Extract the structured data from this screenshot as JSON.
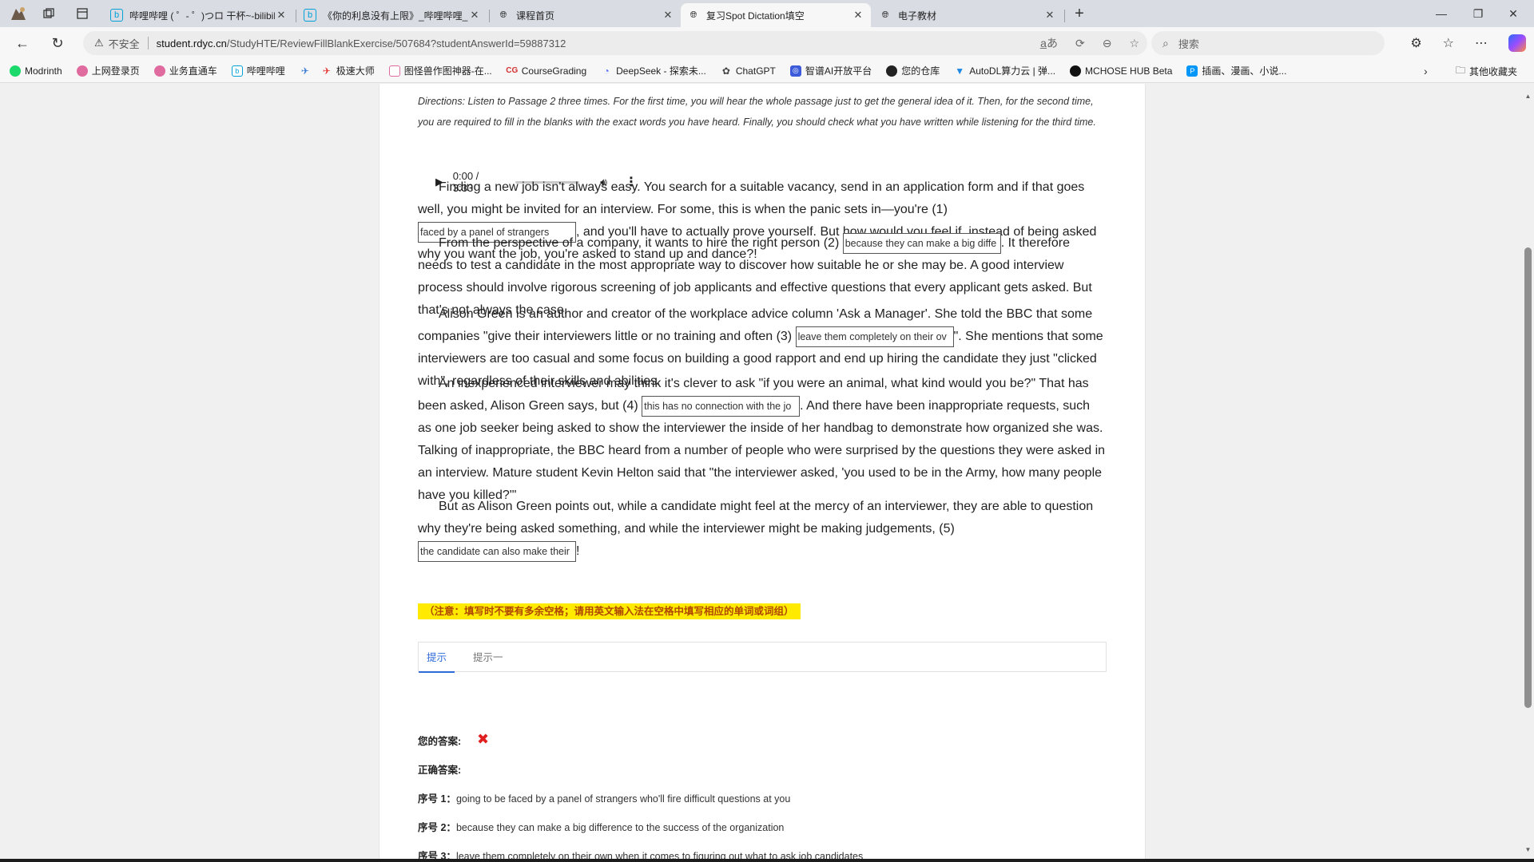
{
  "browser": {
    "tabs": [
      {
        "title": "哔哩哔哩 ( ゜- ゜)つロ 干杯~-bilibili",
        "active": false,
        "color": "#00a1d6"
      },
      {
        "title": "《你的利息没有上限》_哔哩哔哩_bilibili",
        "active": false,
        "color": "#00a1d6"
      },
      {
        "title": "课程首页",
        "active": false,
        "color": "#666666"
      },
      {
        "title": "复习Spot Dictation填空",
        "active": true,
        "color": "#666666"
      },
      {
        "title": "电子教材",
        "active": false,
        "color": "#666666"
      }
    ],
    "address": {
      "insecure_label": "不安全",
      "host": "student.rdyc.cn",
      "path": "/StudyHTE/ReviewFillBlankExercise/507684?studentAnswerId=59887312"
    },
    "search_placeholder": "搜索",
    "bookmarks": [
      {
        "label": "Modrinth",
        "color": "#1bd96a"
      },
      {
        "label": "上网登录页",
        "color": "#e06c9f"
      },
      {
        "label": "业务直通车",
        "color": "#e06c9f"
      },
      {
        "label": "哔哩哔哩",
        "color": "#00a1d6"
      },
      {
        "label": "",
        "color": "#3a7bd5"
      },
      {
        "label": "极速大师",
        "color": "#e53935"
      },
      {
        "label": "图怪兽作图神器-在...",
        "color": "#e06c9f"
      },
      {
        "label": "CourseGrading",
        "color": "#d32f2f"
      },
      {
        "label": "DeepSeek - 探索未...",
        "color": "#4d6bfe"
      },
      {
        "label": "ChatGPT",
        "color": "#444444"
      },
      {
        "label": "智谱AI开放平台",
        "color": "#3b5bdb"
      },
      {
        "label": "您的仓库",
        "color": "#222222"
      },
      {
        "label": "AutoDL算力云 | 弹...",
        "color": "#1e88e5"
      },
      {
        "label": "MCHOSE HUB Beta",
        "color": "#111111"
      },
      {
        "label": "插画、漫画、小说...",
        "color": "#0096fa"
      }
    ],
    "other_bookmarks": "其他收藏夹"
  },
  "exercise": {
    "directions": "Directions: Listen to Passage 2 three times. For the first time, you will hear the whole passage just to get the general idea of it. Then, for the second time, you are required to fill in the blanks with the exact words you have heard. Finally, you should check what you have written while listening for the third time.",
    "audio": {
      "time": "0:00 / 3:33",
      "volume_fraction": 1.0,
      "progress_fraction": 0.0
    },
    "paragraphs": {
      "p1_a": "Finding a new job isn't always easy. You search for a suitable vacancy, send in an application form and if that goes well, you might be invited for an interview. For some, this is when the panic sets in—you're (1) ",
      "blank1": "faced by a panel of strangers",
      "p1_b": ", and you'll have to actually prove yourself. But how would you feel if, instead of being asked why you want the job, you're asked to stand up and dance?!",
      "p2_a": "From the perspective of a company, it wants to hire the right person (2) ",
      "blank2": "because they can make a big diffe",
      "p2_b": ". It therefore needs to test a candidate in the most appropriate way to discover how suitable he or she may be. A good interview process should involve rigorous screening of job applicants and effective questions that every applicant gets asked. But that's not always the case.",
      "p3_a": "Alison Green is an author and creator of the workplace advice column 'Ask a Manager'. She told the BBC that some companies \"give their interviewers little or no training and often (3) ",
      "blank3": "leave them completely on their ov",
      "p3_b": "\". She mentions that some interviewers are too casual and some focus on building a good rapport and end up hiring the candidate they just \"clicked with\", regardless of their skills and abilities.",
      "p4_a": "An inexperienced interviewer may think it's clever to ask \"if you were an animal, what kind would you be?\" That has been asked, Alison Green says, but (4) ",
      "blank4": "this has no connection with the jo",
      "p4_b": ". And there have been inappropriate requests, such as one job seeker being asked to show the interviewer the inside of her handbag to demonstrate how organized she was. Talking of inappropriate, the BBC heard from a number of people who were surprised by the questions they were asked in an interview. Mature student Kevin Helton said that \"the interviewer asked, 'you used to be in the Army, how many people have you killed?'\"",
      "p5_a": "But as Alison Green points out, while a candidate might feel at the mercy of an interviewer, they are able to question why they're being asked something, and while the interviewer might be making judgements, (5) ",
      "blank5": "the candidate can also make their",
      "p5_b": "!"
    },
    "note": "（注意：填写时不要有多余空格；请用英文输入法在空格中填写相应的单词或词组）",
    "hint_tabs": [
      "提示",
      "提示一"
    ],
    "your_answer_label": "您的答案:",
    "correct_answer_label": "正确答案:",
    "answers": [
      {
        "no": "序号 1：",
        "text": "going to be faced by a panel of strangers who'll fire difficult questions at you"
      },
      {
        "no": "序号 2：",
        "text": "because they can make a big difference to the success of the organization"
      },
      {
        "no": "序号 3：",
        "text": "leave them completely on their own when it comes to figuring out what to ask job candidates"
      }
    ]
  }
}
